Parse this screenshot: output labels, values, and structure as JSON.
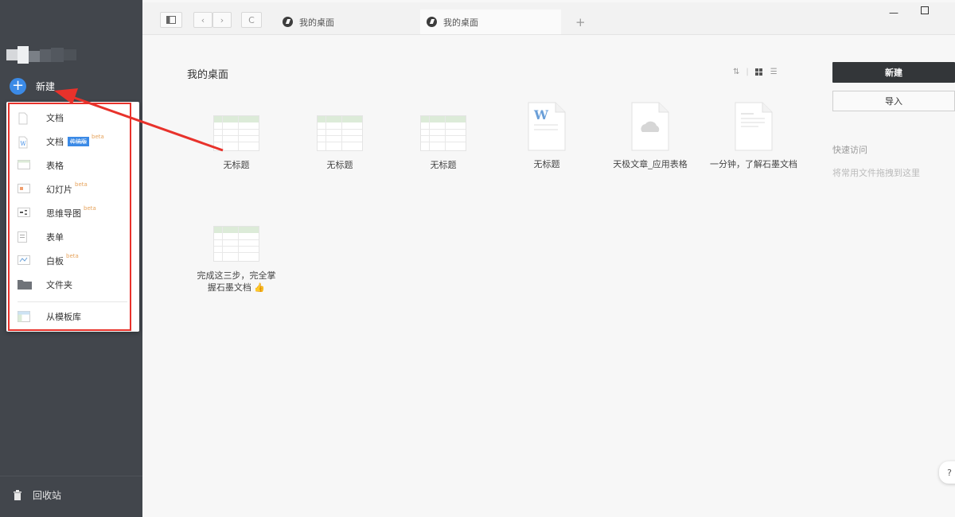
{
  "sidebar": {
    "new_label": "新建",
    "recycle_label": "回收站",
    "menu": [
      {
        "label": "文档",
        "icon": "doc-icon"
      },
      {
        "label": "文档",
        "icon": "word-doc-icon",
        "tag": "传统版",
        "beta": "beta"
      },
      {
        "label": "表格",
        "icon": "sheet-icon"
      },
      {
        "label": "幻灯片",
        "icon": "slides-icon",
        "beta": "beta"
      },
      {
        "label": "思维导图",
        "icon": "mindmap-icon",
        "beta": "beta"
      },
      {
        "label": "表单",
        "icon": "form-icon"
      },
      {
        "label": "白板",
        "icon": "whiteboard-icon",
        "beta": "beta"
      },
      {
        "label": "文件夹",
        "icon": "folder-icon"
      },
      {
        "label": "从模板库",
        "icon": "template-icon"
      }
    ]
  },
  "tabs": [
    {
      "label": "我的桌面",
      "active": false
    },
    {
      "label": "我的桌面",
      "active": true
    }
  ],
  "toolbar": {
    "new_tab": "+",
    "refresh": "C"
  },
  "main": {
    "title": "我的桌面",
    "files": [
      {
        "name": "无标题",
        "type": "sheet"
      },
      {
        "name": "无标题",
        "type": "sheet"
      },
      {
        "name": "无标题",
        "type": "sheet"
      },
      {
        "name": "无标题",
        "type": "word"
      },
      {
        "name": "天极文章_应用表格",
        "type": "cloud"
      },
      {
        "name": "一分钟，了解石墨文档",
        "type": "doc"
      },
      {
        "name": "完成这三步，完全掌握石墨文档 👍",
        "type": "sheet"
      }
    ]
  },
  "right_panel": {
    "new_button": "新建",
    "import_button": "导入",
    "quick_access_title": "快速访问",
    "quick_access_hint": "将常用文件拖拽到这里"
  },
  "colors": {
    "accent": "#3b8ae6",
    "annotation": "#e8322b",
    "sidebar_bg": "#42464c"
  }
}
